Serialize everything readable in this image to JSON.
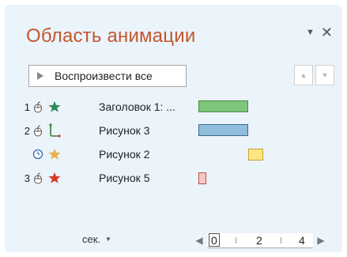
{
  "pane": {
    "title": "Область анимации",
    "menu_icon": "chevron-down-icon",
    "close_label": "✕"
  },
  "toolbar": {
    "play_all_label": "Воспроизвести все",
    "move_up_icon": "triangle-up-icon",
    "move_down_icon": "triangle-down-icon"
  },
  "items": [
    {
      "number": "1",
      "trigger": "mouse-click-icon",
      "effect": "star-icon",
      "effect_color": "#2e8b57",
      "label": "Заголовок 1: ...",
      "bar_color": "#7dc67a",
      "bar_border": "#4a8a3a"
    },
    {
      "number": "2",
      "trigger": "mouse-click-icon",
      "effect": "motion-path-icon",
      "effect_color": "#3a7a3a",
      "label": "Рисунок 3",
      "bar_color": "#8fbfdd",
      "bar_border": "#3c6a8a"
    },
    {
      "number": "",
      "trigger": "clock-icon",
      "effect": "star-icon",
      "effect_color": "#e8b04a",
      "label": "Рисунок 2",
      "bar_color": "#ffe680",
      "bar_border": "#c8a23a"
    },
    {
      "number": "3",
      "trigger": "mouse-click-icon",
      "effect": "star-icon",
      "effect_color": "#d63a2a",
      "label": "Рисунок 5",
      "bar_color": "#f7c6c6",
      "bar_border": "#c0504d"
    }
  ],
  "footer": {
    "units_label": "сек.",
    "units_caret": "▼",
    "prev_label": "◀",
    "next_label": "▶",
    "ticks": [
      "0",
      "2",
      "4"
    ]
  }
}
